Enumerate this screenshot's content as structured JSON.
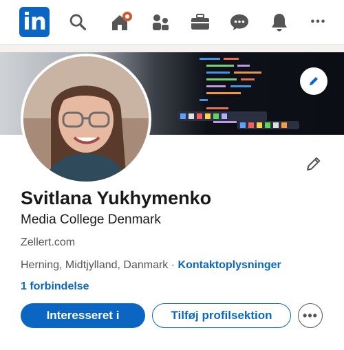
{
  "nav": {
    "logo_text": "in",
    "more_label": "•••"
  },
  "profile": {
    "name": "Svitlana Yukhymenko",
    "headline": "Media College Denmark",
    "website": "Zellert.com",
    "location": "Herning, Midtjylland, Danmark",
    "separator": " · ",
    "contact_link": "Kontaktoplysninger",
    "connections": "1 forbindelse"
  },
  "actions": {
    "primary": "Interesseret i",
    "secondary": "Tilføj profilsektion",
    "more": "•••"
  },
  "colors": {
    "brand": "#0a66c2",
    "notification": "#cc5a2a"
  }
}
